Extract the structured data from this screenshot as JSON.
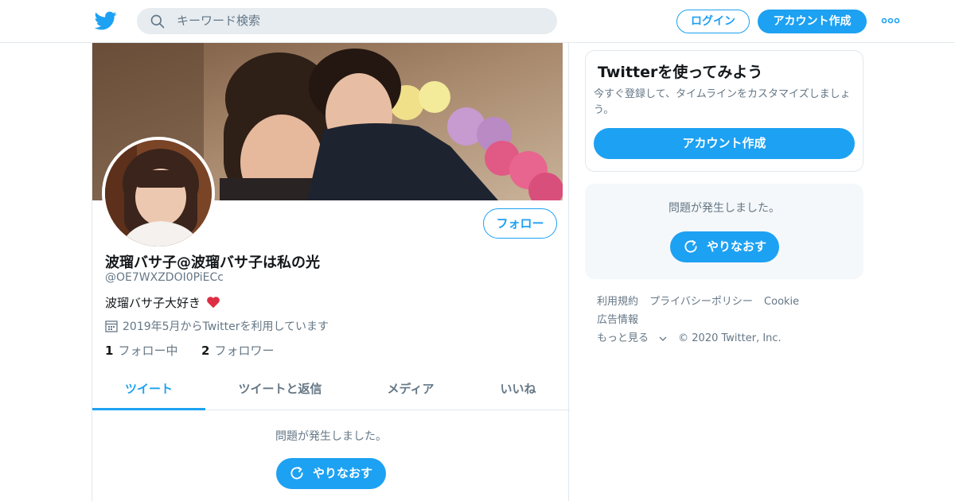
{
  "header": {
    "search_placeholder": "キーワード検索",
    "login_label": "ログイン",
    "signup_label": "アカウント作成"
  },
  "profile": {
    "display_name": "波瑠バサ子@波瑠バサ子は私の光",
    "handle": "@OE7WXZDOI0PiECc",
    "bio": "波瑠バサ子大好き",
    "joined": "2019年5月からTwitterを利用しています",
    "follow_label": "フォロー",
    "following_count": "1",
    "following_label": "フォロー中",
    "followers_count": "2",
    "followers_label": "フォロワー"
  },
  "tabs": [
    {
      "label": "ツイート"
    },
    {
      "label": "ツイートと返信"
    },
    {
      "label": "メディア"
    },
    {
      "label": "いいね"
    }
  ],
  "timeline": {
    "error_text": "問題が発生しました。",
    "retry_label": "やりなおす"
  },
  "sidebar": {
    "signup_card": {
      "title": "Twitterを使ってみよう",
      "description": "今すぐ登録して、タイムラインをカスタマイズしましょう。",
      "button_label": "アカウント作成"
    },
    "error_card": {
      "error_text": "問題が発生しました。",
      "retry_label": "やりなおす"
    },
    "footer_links": [
      "利用規約",
      "プライバシーポリシー",
      "Cookie",
      "広告情報",
      "もっと見る"
    ],
    "copyright": "© 2020 Twitter, Inc."
  },
  "colors": {
    "accent": "#1da1f2",
    "secondary_text": "#657786",
    "border": "#e1e8ed"
  }
}
